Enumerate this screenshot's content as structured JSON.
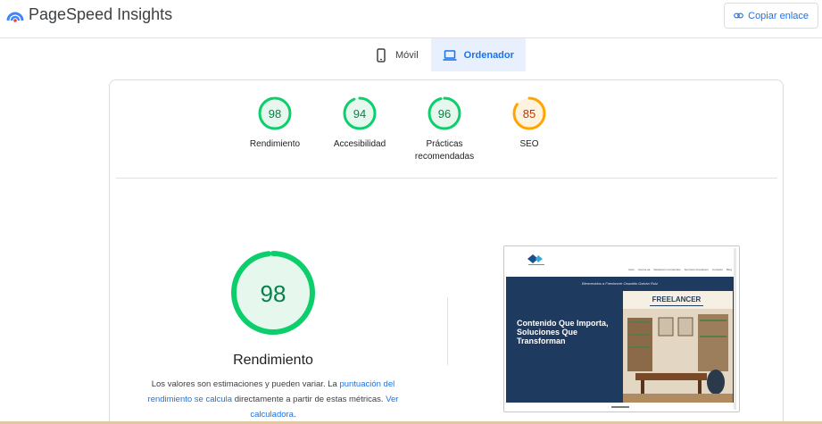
{
  "header": {
    "app_title": "PageSpeed Insights",
    "copy_label": "Copiar enlace"
  },
  "tabs": [
    {
      "label": "Móvil",
      "icon": "phone-icon",
      "active": false
    },
    {
      "label": "Ordenador",
      "icon": "laptop-icon",
      "active": true
    }
  ],
  "scores": [
    {
      "value": "98",
      "label": "Rendimiento",
      "color": "#0cce6b"
    },
    {
      "value": "94",
      "label": "Accesibilidad",
      "color": "#0cce6b"
    },
    {
      "value": "96",
      "label": "Prácticas recomendadas",
      "color": "#0cce6b"
    },
    {
      "value": "85",
      "label": "SEO",
      "color": "#ffa400"
    }
  ],
  "main_score": {
    "value": "98",
    "title": "Rendimiento",
    "color": "#0cce6b"
  },
  "description": {
    "part1": "Los valores son estimaciones y pueden variar. La ",
    "link1": "puntuación del rendimiento se calcula",
    "part2": " directamente a partir de estas métricas. ",
    "link2": "Ver calculadora",
    "part3": "."
  },
  "preview": {
    "brand_caption": "",
    "menu": [
      "Inicio",
      "Acerca de",
      "Redacción Contenidos",
      "Servicios Freelancer",
      "Contacto",
      "Blog"
    ],
    "welcome": "Bienvenidos a Freelancer Oswaldo Galván Ruiz",
    "headline": "Contenido Que Importa, Soluciones Que Transforman",
    "image_title": "FREELANCER"
  }
}
